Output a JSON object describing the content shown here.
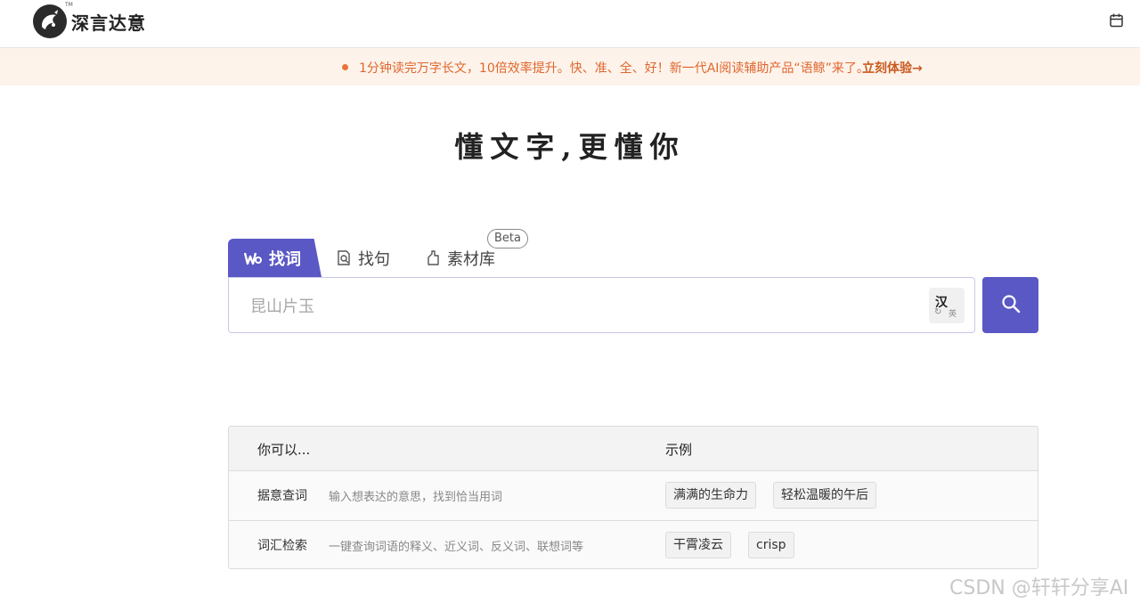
{
  "header": {
    "logo_text": "深言达意",
    "logo_tm": "TM",
    "calendar_icon": "calendar-icon"
  },
  "notice": {
    "text": "1分钟读完万字长文，10倍效率提升。快、准、全、好！新一代AI阅读辅助产品“语鲸”来了。",
    "link": "立刻体验→",
    "color": "#e0662e"
  },
  "slogan": "懂文字,更懂你",
  "tabs": [
    {
      "label": "找词",
      "icon": "word-icon",
      "active": true
    },
    {
      "label": "找句",
      "icon": "sentence-search-icon",
      "active": false
    },
    {
      "label": "素材库",
      "icon": "material-icon",
      "active": false,
      "badge": "Beta"
    }
  ],
  "search": {
    "placeholder": "昆山片玉",
    "value": "",
    "lang_toggle": {
      "zh": "汉",
      "en": "英"
    }
  },
  "guide": {
    "headers": [
      "你可以...",
      "示例"
    ],
    "rows": [
      {
        "title": "据意查词",
        "desc": "输入想表达的意思，找到恰当用词",
        "examples": [
          "满满的生命力",
          "轻松温暖的午后"
        ]
      },
      {
        "title": "词汇检索",
        "desc": "一键查询词语的释义、近义词、反义词、联想词等",
        "examples": [
          "干霄凌云",
          "crisp"
        ]
      }
    ]
  },
  "watermark": "CSDN @轩轩分享AI",
  "colors": {
    "accent": "#5a58c4",
    "notice_bg": "#fdf3ea"
  }
}
